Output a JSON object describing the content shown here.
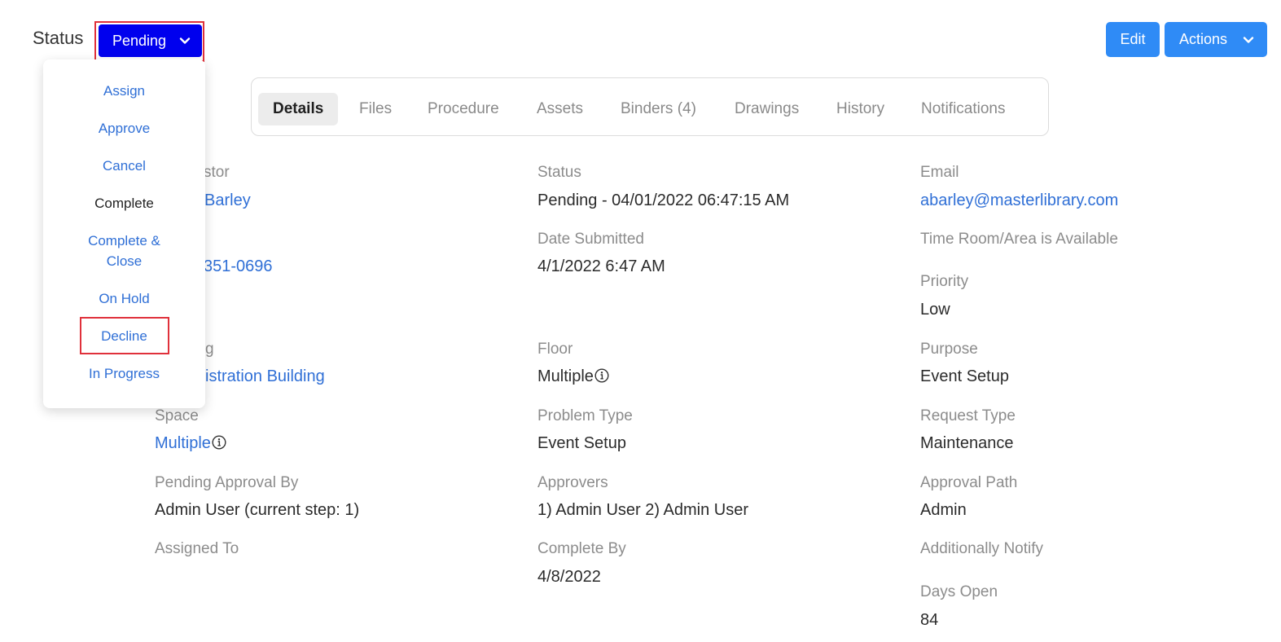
{
  "header": {
    "status_label": "Status",
    "status_value": "Pending",
    "edit_label": "Edit",
    "actions_label": "Actions"
  },
  "tabs": [
    "Details",
    "Files",
    "Procedure",
    "Assets",
    "Binders (4)",
    "Drawings",
    "History",
    "Notifications"
  ],
  "active_tab": "Details",
  "status_menu": [
    "Assign",
    "Approve",
    "Cancel",
    "Complete",
    "Complete &",
    "Close",
    "On Hold",
    "Decline",
    "In Progress"
  ],
  "fields": {
    "requestor_label": "stor",
    "requestor_value": "Barley",
    "phone_value": "351-0696",
    "building_label": "g",
    "building_value": "istration Building",
    "space_label": "Space",
    "space_value": "Multiple",
    "pending_approval_label": "Pending Approval By",
    "pending_approval_value": "Admin User (current step: 1)",
    "assigned_to_label": "Assigned To",
    "status_label": "Status",
    "status_value": "Pending - 04/01/2022 06:47:15 AM",
    "date_submitted_label": "Date Submitted",
    "date_submitted_value": "4/1/2022 6:47 AM",
    "floor_label": "Floor",
    "floor_value": "Multiple",
    "problem_type_label": "Problem Type",
    "problem_type_value": "Event Setup",
    "approvers_label": "Approvers",
    "approvers_value": "1) Admin User 2) Admin User",
    "complete_by_label": "Complete By",
    "complete_by_value": "4/8/2022",
    "email_label": "Email",
    "email_value": "abarley@masterlibrary.com",
    "time_room_label": "Time Room/Area is Available",
    "priority_label": "Priority",
    "priority_value": "Low",
    "purpose_label": "Purpose",
    "purpose_value": "Event Setup",
    "request_type_label": "Request Type",
    "request_type_value": "Maintenance",
    "approval_path_label": "Approval Path",
    "approval_path_value": "Admin",
    "additionally_notify_label": "Additionally Notify",
    "days_open_label": "Days Open",
    "days_open_value": "84"
  },
  "colors": {
    "pending_button": "#0000ee",
    "primary_button": "#2f8bf6",
    "link": "#2f6fd6",
    "highlight": "#e0313b"
  }
}
